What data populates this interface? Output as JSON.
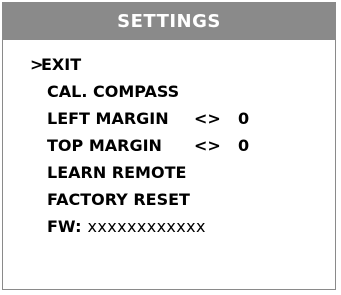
{
  "header": {
    "title": "SETTINGS"
  },
  "menu": {
    "cursor": ">",
    "items": [
      {
        "label": "EXIT"
      },
      {
        "label": "CAL. COMPASS"
      },
      {
        "label": "LEFT MARGIN",
        "arrows": "<>",
        "value": "0"
      },
      {
        "label": "TOP MARGIN",
        "arrows": "<>",
        "value": "0"
      },
      {
        "label": "LEARN REMOTE"
      },
      {
        "label": "FACTORY RESET"
      }
    ],
    "firmware": {
      "label": "FW:",
      "value": "xxxxxxxxxxxx"
    }
  },
  "colors": {
    "title_bar": "#8a8a8a",
    "title_text": "#ffffff",
    "border": "#8a8a8a",
    "text": "#000000"
  }
}
